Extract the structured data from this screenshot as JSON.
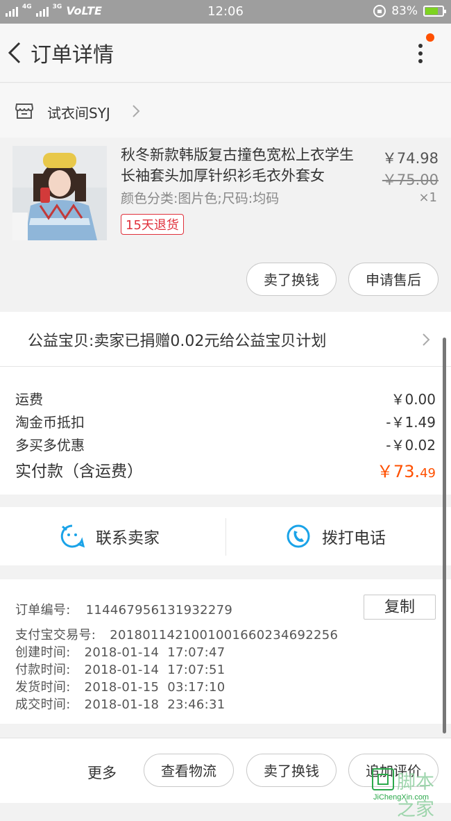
{
  "status_bar": {
    "network_top": "4G",
    "network_second": "3G",
    "volte": "VoLTE",
    "time": "12:06",
    "battery_percent": "83%",
    "battery_level": 0.83
  },
  "header": {
    "title": "订单详情"
  },
  "shop": {
    "name": "试衣间SYJ"
  },
  "item": {
    "title": "秋冬新款韩版复古撞色宽松上衣学生长袖套头加厚针织衫毛衣外套女",
    "attributes": "颜色分类:图片色;尺码:均码",
    "badge": "15天退货",
    "price": "￥74.98",
    "original_price": "￥75.00",
    "quantity": "×1",
    "actions": [
      "卖了换钱",
      "申请售后"
    ]
  },
  "charity": {
    "text": "公益宝贝:卖家已捐赠0.02元给公益宝贝计划"
  },
  "fees": [
    {
      "label": "运费",
      "value": "￥0.00"
    },
    {
      "label": "淘金币抵扣",
      "value": "-￥1.49"
    },
    {
      "label": "多买多优惠",
      "value": "-￥0.02"
    }
  ],
  "total": {
    "label": "实付款（含运费）",
    "value_main": "￥73.",
    "value_cents": "49"
  },
  "contact": {
    "seller_label": "联系卖家",
    "phone_label": "拨打电话"
  },
  "order_info": {
    "order_no_label": "订单编号:",
    "order_no": "114467956131932279",
    "copy_label": "复制",
    "alipay_label": "支付宝交易号:",
    "alipay_no": "2018011421001001660234692256",
    "created_label": "创建时间:",
    "created": "2018-01-14  17:07:47",
    "paid_label": "付款时间:",
    "paid": "2018-01-14  17:07:51",
    "shipped_label": "发货时间:",
    "shipped": "2018-01-15  03:17:10",
    "completed_label": "成交时间:",
    "completed": "2018-01-18  23:46:31"
  },
  "bottom_bar": {
    "more": "更多",
    "buttons": [
      "查看物流",
      "卖了换钱",
      "追加评价"
    ]
  },
  "watermark": {
    "text": "脚本之家",
    "site": "JiChengXin.com"
  },
  "colors": {
    "accent_orange": "#ff5000",
    "badge_red": "#e0303b",
    "icon_blue": "#1aa3e8"
  }
}
